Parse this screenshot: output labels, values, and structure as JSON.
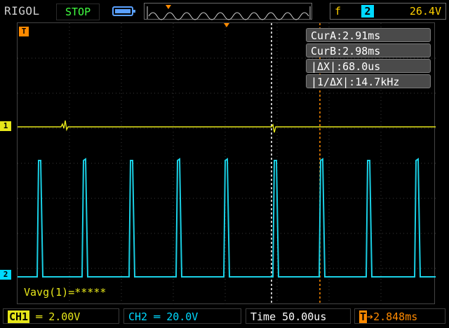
{
  "header": {
    "brand": "RIGOL",
    "run_status": "STOP",
    "trigger": {
      "edge_symbol": "f",
      "source_channel": "2",
      "level": "26.4V"
    }
  },
  "channel_markers": {
    "ch1": "1",
    "ch2": "2",
    "trigger_marker": "T"
  },
  "cursor_readouts": {
    "cur_a": "CurA:2.91ms",
    "cur_b": "CurB:2.98ms",
    "delta_x": "|ΔX|:68.0us",
    "inv_delta_x": "|1/ΔX|:14.7kHz"
  },
  "measurement": {
    "vavg": "Vavg(1)=*****"
  },
  "footer": {
    "ch1_label": "CH1",
    "ch1_scale": "2.00V",
    "ch2_label": "CH2",
    "ch2_scale": "20.0V",
    "time_label": "Time",
    "time_scale": "50.00us",
    "trigger_delay_icon": "T",
    "trigger_delay": "2.848ms"
  },
  "colors": {
    "ch1": "#e6e61a",
    "ch2": "#00d9ff",
    "trigger": "#ff8a00",
    "status_stop": "#41ff41"
  }
}
